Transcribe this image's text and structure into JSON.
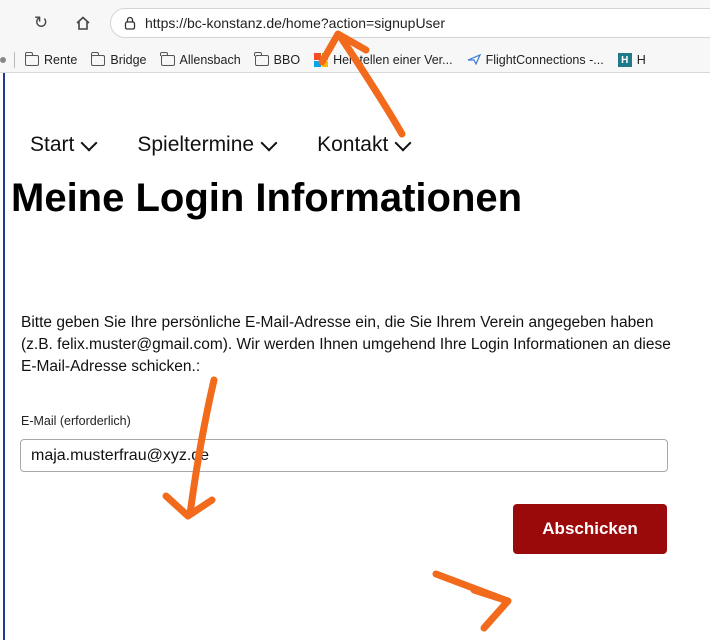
{
  "browser": {
    "url": "https://bc-konstanz.de/home?action=signupUser",
    "reload_icon": "reload-icon",
    "home_icon": "home-icon",
    "site_info_icon": "site-info-icon",
    "bookmarks": [
      {
        "label": "Rente",
        "icon": "folder-icon"
      },
      {
        "label": "Bridge",
        "icon": "folder-icon"
      },
      {
        "label": "Allensbach",
        "icon": "folder-icon"
      },
      {
        "label": "BBO",
        "icon": "folder-icon"
      },
      {
        "label": "Herstellen einer Ver...",
        "icon": "ms-tile-icon"
      },
      {
        "label": "FlightConnections -...",
        "icon": "flight-icon"
      },
      {
        "label": "H",
        "icon": "h-icon"
      }
    ]
  },
  "menu": {
    "items": [
      {
        "label": "Start"
      },
      {
        "label": "Spieltermine"
      },
      {
        "label": "Kontakt"
      }
    ]
  },
  "main": {
    "title": "Meine Login Informationen",
    "intro": "Bitte geben Sie Ihre persönliche E-Mail-Adresse ein, die Sie Ihrem Verein angegeben haben (z.B. felix.muster@gmail.com). Wir werden Ihnen umgehend Ihre Login Informationen an diese E-Mail-Adresse schicken.:",
    "email_label": "E-Mail (erforderlich)",
    "email_value": "maja.musterfrau@xyz.de",
    "submit_label": "Abschicken"
  },
  "colors": {
    "accent": "#9b0a0a",
    "annotation": "#f26a1b"
  }
}
